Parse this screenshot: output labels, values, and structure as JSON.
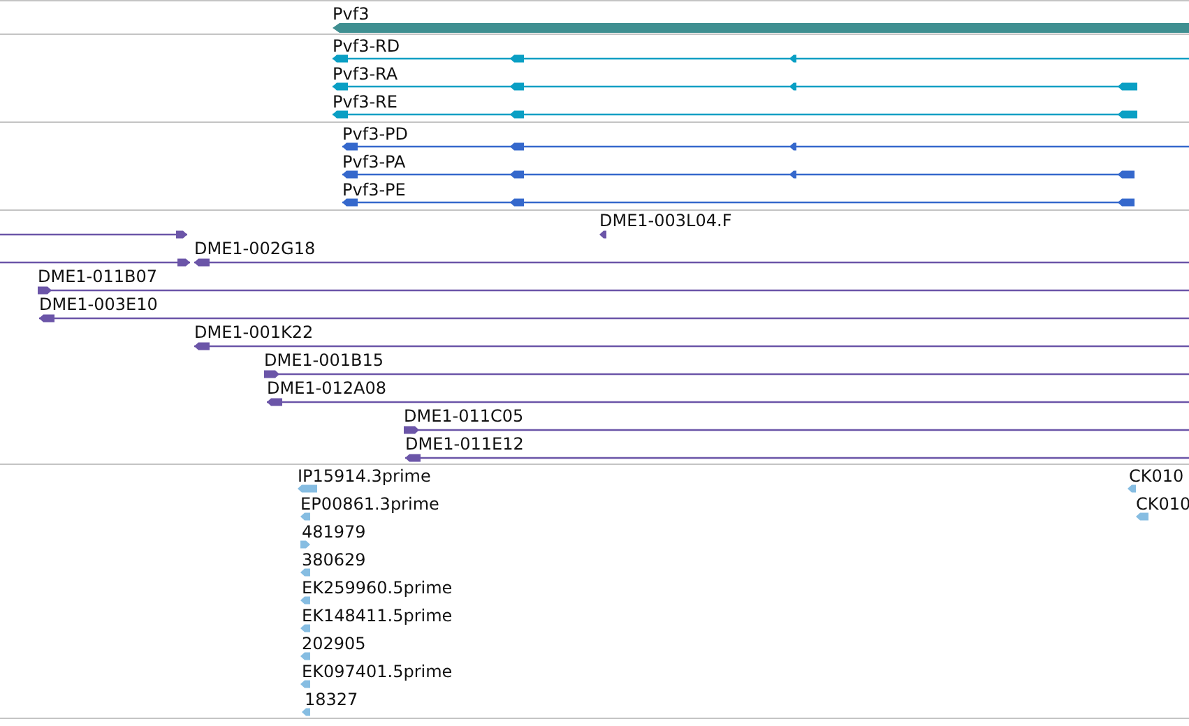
{
  "tracks": [
    {
      "kind": "gene",
      "color": "#3f8f91",
      "features": [
        {
          "label": "Pvf3",
          "forward": false
        }
      ]
    },
    {
      "kind": "transcript",
      "color": "#0a9fc4",
      "features": [
        {
          "label": "Pvf3-RD",
          "forward": false
        },
        {
          "label": "Pvf3-RA",
          "forward": false
        },
        {
          "label": "Pvf3-RE",
          "forward": false
        }
      ]
    },
    {
      "kind": "transcript",
      "color": "#3568cc",
      "features": [
        {
          "label": "Pvf3-PD",
          "forward": false
        },
        {
          "label": "Pvf3-PA",
          "forward": false
        },
        {
          "label": "Pvf3-PE",
          "forward": false
        }
      ]
    },
    {
      "kind": "clone",
      "color": "#6b55a8",
      "features": [
        {
          "forward": true
        },
        {
          "label": "DME1-003L04.F",
          "forward": false
        },
        {
          "forward": true
        },
        {
          "label": "DME1-002G18",
          "forward": false
        },
        {
          "label": "DME1-011B07",
          "forward": true
        },
        {
          "label": "DME1-003E10",
          "forward": false
        },
        {
          "label": "DME1-001K22",
          "forward": false
        },
        {
          "label": "DME1-001B15",
          "forward": true
        },
        {
          "label": "DME1-012A08",
          "forward": false
        },
        {
          "label": "DME1-011C05",
          "forward": true
        },
        {
          "label": "DME1-011E12",
          "forward": false
        }
      ]
    },
    {
      "kind": "est",
      "color": "#86bde2",
      "features": [
        {
          "label": "IP15914.3prime",
          "forward": false
        },
        {
          "label": "EP00861.3prime",
          "forward": false
        },
        {
          "label": "481979",
          "forward": true
        },
        {
          "label": "380629",
          "forward": false
        },
        {
          "label": "EK259960.5prime",
          "forward": false
        },
        {
          "label": "EK148411.5prime",
          "forward": false
        },
        {
          "label": "202905",
          "forward": false
        },
        {
          "label": "EK097401.5prime",
          "forward": false
        },
        {
          "label": "18327",
          "forward": false
        },
        {
          "label": "CK010",
          "forward": false
        },
        {
          "label": "CK010",
          "forward": false
        }
      ]
    }
  ]
}
